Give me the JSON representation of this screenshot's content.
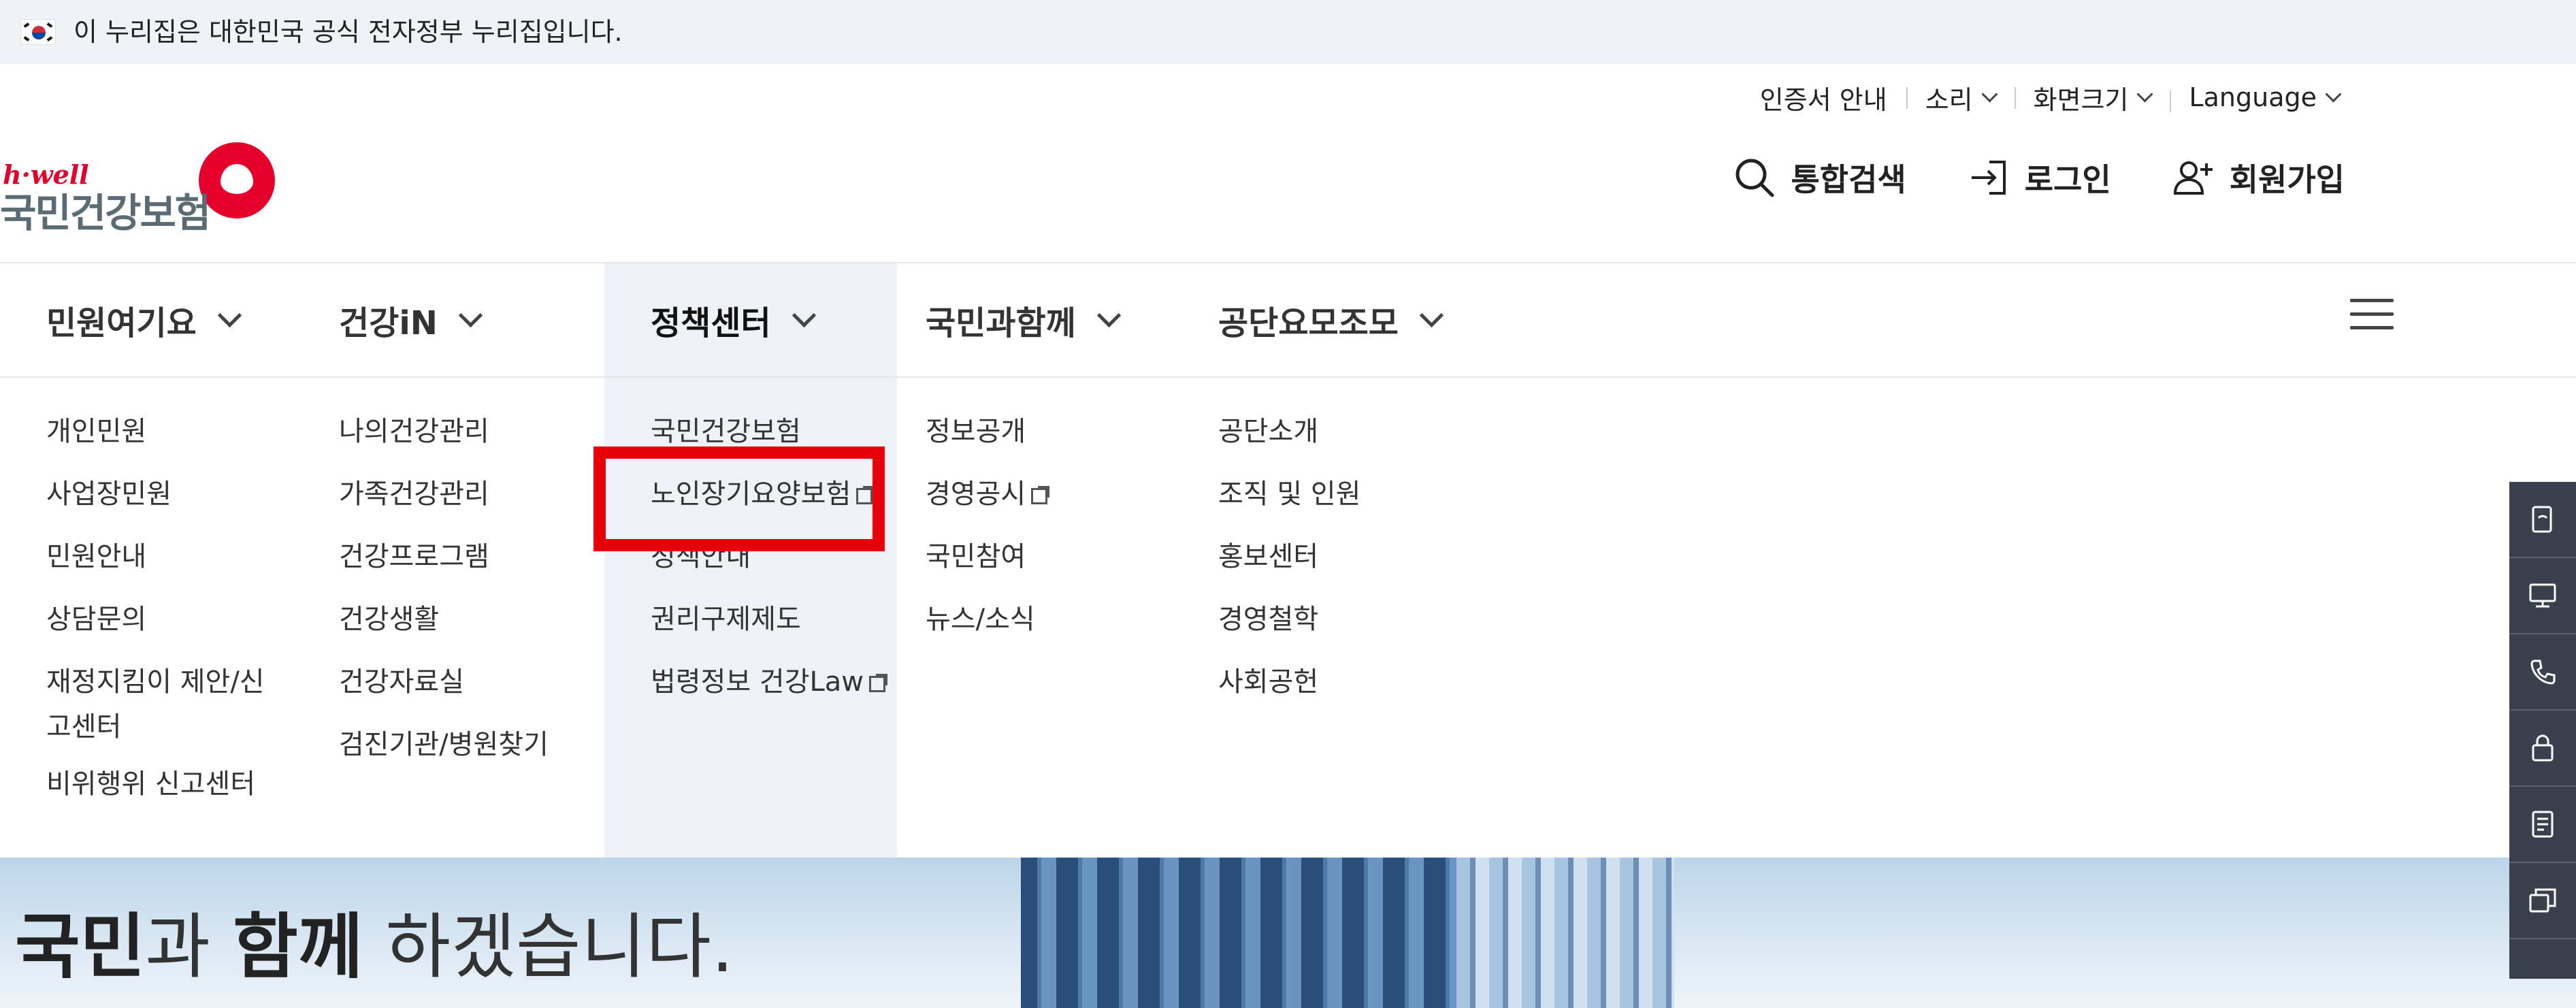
{
  "gov_banner": {
    "text": "이 누리집은 대한민국 공식 전자정부 누리집입니다."
  },
  "util_menu": [
    {
      "label": "인증서 안내",
      "has_dropdown": false
    },
    {
      "label": "소리",
      "has_dropdown": true
    },
    {
      "label": "화면크기",
      "has_dropdown": true
    },
    {
      "label": "Language",
      "has_dropdown": true
    }
  ],
  "logo": {
    "tagline": "h·well",
    "name": "국민건강보험"
  },
  "actions": {
    "search": "통합검색",
    "login": "로그인",
    "signup": "회원가입"
  },
  "gnb": [
    {
      "label": "민원여기요",
      "active": false
    },
    {
      "label": "건강iN",
      "active": false
    },
    {
      "label": "정책센터",
      "active": true
    },
    {
      "label": "국민과함께",
      "active": false
    },
    {
      "label": "공단요모조모",
      "active": false
    }
  ],
  "dropdown": {
    "col1": [
      "개인민원",
      "사업장민원",
      "민원안내",
      "상담문의",
      "재정지킴이 제안/신고센터",
      "비위행위 신고센터"
    ],
    "col2": [
      "나의건강관리",
      "가족건강관리",
      "건강프로그램",
      "건강생활",
      "건강자료실",
      "검진기관/병원찾기"
    ],
    "col3": [
      "국민건강보험",
      "노인장기요양보험",
      "정책안내",
      "권리구제제도",
      "법령정보 건강Law"
    ],
    "col4": [
      "정보공개",
      "경영공시",
      "국민참여",
      "뉴스/소식"
    ],
    "col5": [
      "공단소개",
      "조직 및 인원",
      "홍보센터",
      "경영철학",
      "사회공헌"
    ]
  },
  "hero": {
    "line_bold1": "국민",
    "line_mid": "과 ",
    "line_bold2": "함께",
    "line_end": " 하겠습니다."
  },
  "colors": {
    "highlight": "#e8000b",
    "brand_red": "#e4002b",
    "quick_bg": "#3b414c"
  }
}
